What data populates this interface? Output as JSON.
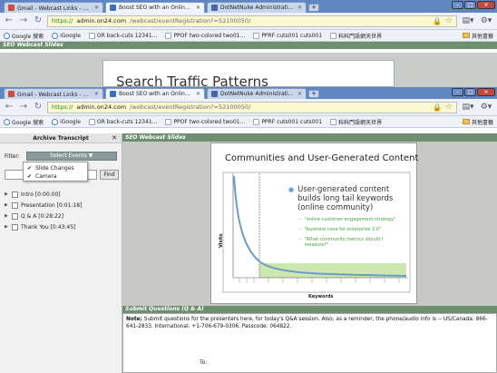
{
  "window1": {
    "tabs": [
      {
        "title": "Gmail - Webcast Links - 雅...",
        "color": "#d54b3c",
        "active": false
      },
      {
        "title": "Boost SEO with an Online C...",
        "color": "#3a6fc0",
        "active": true
      },
      {
        "title": "DotNetNuke Administration",
        "color": "#4466aa",
        "active": false
      }
    ],
    "url": {
      "scheme": "https://",
      "host": "admin.on24.com",
      "path": "/webcast/eventRegistration?=52100050/"
    },
    "bookmarks": [
      "Google 搜索",
      "iGoogle",
      "OR back-cuts 12341...",
      "PPOF two-colored two01...",
      "PPRF cuts001 cuts001",
      "科科門設網天世界"
    ],
    "other_bookmarks": "其他書籤",
    "webcast_header": "SEO Webcast Slides",
    "slide_title": "Search Traffic Patterns"
  },
  "window2": {
    "tabs": [
      {
        "title": "Gmail - Webcast Links - 雅...",
        "color": "#d54b3c",
        "active": false
      },
      {
        "title": "Boost SEO with an Online C...",
        "color": "#3a6fc0",
        "active": true
      },
      {
        "title": "DotNetNuke Administration",
        "color": "#4466aa",
        "active": false
      }
    ],
    "url": {
      "scheme": "https://",
      "host": "admin.on24.com",
      "path": "/webcast/eventRegistration?=52100050/"
    },
    "bookmarks": [
      "Google 搜索",
      "iGoogle",
      "OR back-cuts 12341...",
      "PPOF two-colored two01...",
      "PPRF cuts001 cuts001",
      "科科門設網天世界"
    ],
    "other_bookmarks": "其他書籤"
  },
  "panel": {
    "title": "Archive Transcript",
    "filter_label": "Filter:",
    "select_events": "Select Events ▼",
    "find": "Find",
    "dropdown": [
      "Slide Changes",
      "Camera"
    ],
    "tree": [
      "Intro [0:00:00]",
      "Presentation [0:01:18]",
      "Q & A [0:28:22]",
      "Thank You [0:43:45]"
    ]
  },
  "main": {
    "header": "SEO Webcast Slides",
    "slide_title": "Communities and User-Generated Content",
    "bullet_main": "User-generated content builds long tail keywords (online community)",
    "sub_bullets": [
      "\"online customer engagement strategy\"",
      "\"business case for enterprise 2.0\"",
      "\"What community metrics should I measure?\""
    ],
    "ylabel": "Visits",
    "xlabel": "Keywords"
  },
  "questions": {
    "header": "Submit Questions (Q & A)",
    "note_label": "Note:",
    "note": "Submit questions for the presenters here, for today's Q&A session. Also, as a reminder, the phone/audio info is -- US/Canada: 866-641-2833. International: +1-706-679-0306. Passcode: 064822.",
    "to": "To:"
  },
  "colors": {
    "tabbar": "#5f86c0",
    "webcast_green": "#6c8f6f",
    "curve": "#6a9cc4",
    "band": "#cce8b0"
  }
}
